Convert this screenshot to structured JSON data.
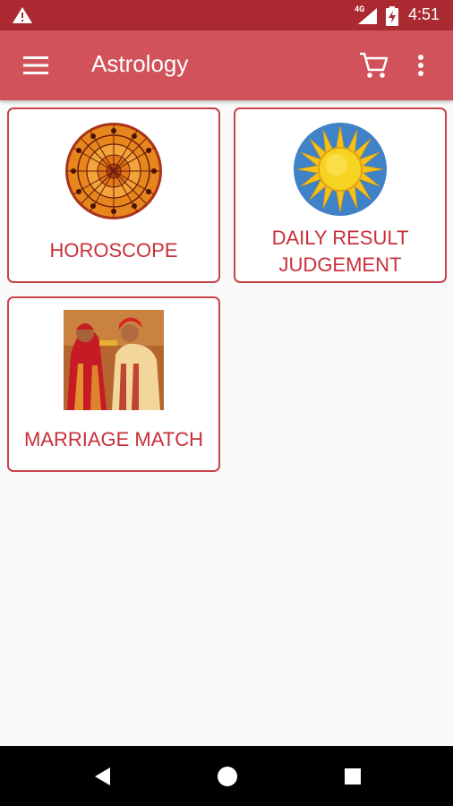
{
  "status_bar": {
    "network": "4G",
    "time": "4:51",
    "icons": [
      "warning-icon",
      "signal-icon",
      "battery-charging-icon"
    ]
  },
  "app_bar": {
    "title": "Astrology",
    "icons": [
      "menu-icon",
      "cart-icon",
      "more-vert-icon"
    ]
  },
  "cards": [
    {
      "label": "HOROSCOPE",
      "image": "zodiac-wheel-image"
    },
    {
      "label_line1": "DAILY RESULT",
      "label_line2": "JUDGEMENT",
      "image": "sun-image"
    },
    {
      "label": "MARRIAGE MATCH",
      "image": "wedding-couple-image"
    }
  ],
  "nav_bar": {
    "icons": [
      "back-icon",
      "home-icon",
      "recents-icon"
    ]
  },
  "colors": {
    "status_bar": "#ab2a32",
    "app_bar": "#d1525a",
    "card_border": "#c8434b",
    "card_text": "#c8303a",
    "background": "#fafafa"
  }
}
